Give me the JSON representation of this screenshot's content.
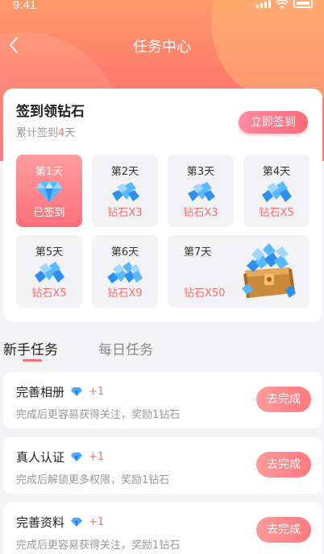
{
  "status_bar": {
    "time": "9:41"
  },
  "nav": {
    "title": "任务中心",
    "back_icon": "chevron-left-icon"
  },
  "sign_in": {
    "title": "签到领钻石",
    "subtitle_prefix": "累计签到",
    "days_count": "4",
    "subtitle_suffix": "天",
    "button": "立即签到",
    "days": [
      {
        "label": "第1天",
        "reward": "已签到",
        "icon": "diamond-icon",
        "signed": true
      },
      {
        "label": "第2天",
        "reward": "钻石X3",
        "icon": "diamond-pile-icon",
        "signed": false
      },
      {
        "label": "第3天",
        "reward": "钻石X3",
        "icon": "diamond-pile-icon",
        "signed": false
      },
      {
        "label": "第4天",
        "reward": "钻石X5",
        "icon": "diamond-pile-icon",
        "signed": false
      },
      {
        "label": "第5天",
        "reward": "钻石X5",
        "icon": "diamond-pile-icon",
        "signed": false
      },
      {
        "label": "第6天",
        "reward": "钻石X9",
        "icon": "diamond-pile-icon",
        "signed": false
      },
      {
        "label": "第7天",
        "reward": "钻石X50",
        "icon": "treasure-chest-icon",
        "signed": false
      }
    ]
  },
  "tabs": [
    {
      "label": "新手任务",
      "active": true
    },
    {
      "label": "每日任务",
      "active": false
    }
  ],
  "tasks": [
    {
      "name": "完善相册",
      "bonus": "+1",
      "desc": "完成后更容易获得关注，奖励1钻石",
      "button": "去完成"
    },
    {
      "name": "真人认证",
      "bonus": "+1",
      "desc": "完成后解锁更多权限，奖励1钻石",
      "button": "去完成"
    },
    {
      "name": "完善资料",
      "bonus": "+1",
      "desc": "完成后更容易获得关注，奖励1钻石",
      "button": "去完成"
    }
  ],
  "colors": {
    "accent": "#ff6b78",
    "hero_top": "#ff9a6a",
    "diamond": "#4aa8ff"
  }
}
